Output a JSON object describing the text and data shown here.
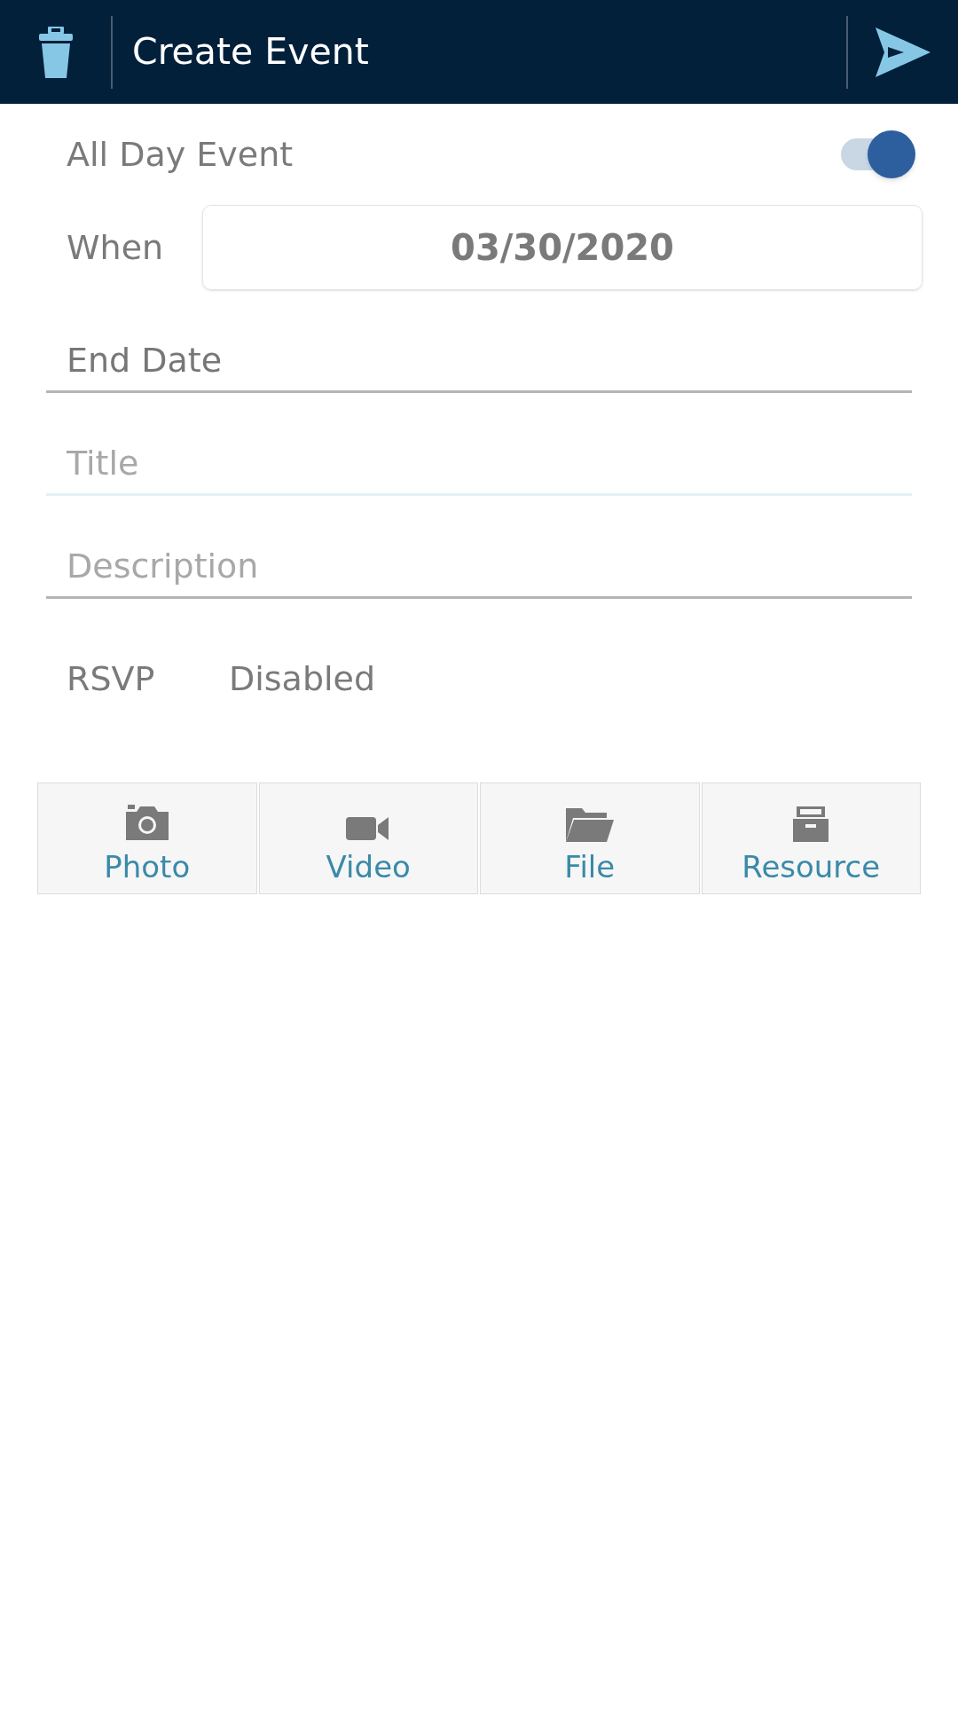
{
  "header": {
    "title": "Create Event"
  },
  "all_day": {
    "label": "All Day Event",
    "on": true
  },
  "when": {
    "label": "When",
    "value": "03/30/2020"
  },
  "fields": [
    {
      "kind": "date",
      "placeholder": "End Date",
      "focused": false
    },
    {
      "kind": "text",
      "placeholder": "Title",
      "focused": true
    },
    {
      "kind": "text",
      "placeholder": "Description",
      "focused": false
    }
  ],
  "rsvp": {
    "label": "RSVP",
    "value": "Disabled"
  },
  "attachments": [
    {
      "kind": "photo",
      "label": "Photo"
    },
    {
      "kind": "video",
      "label": "Video"
    },
    {
      "kind": "file",
      "label": "File"
    },
    {
      "kind": "resource",
      "label": "Resource"
    }
  ]
}
